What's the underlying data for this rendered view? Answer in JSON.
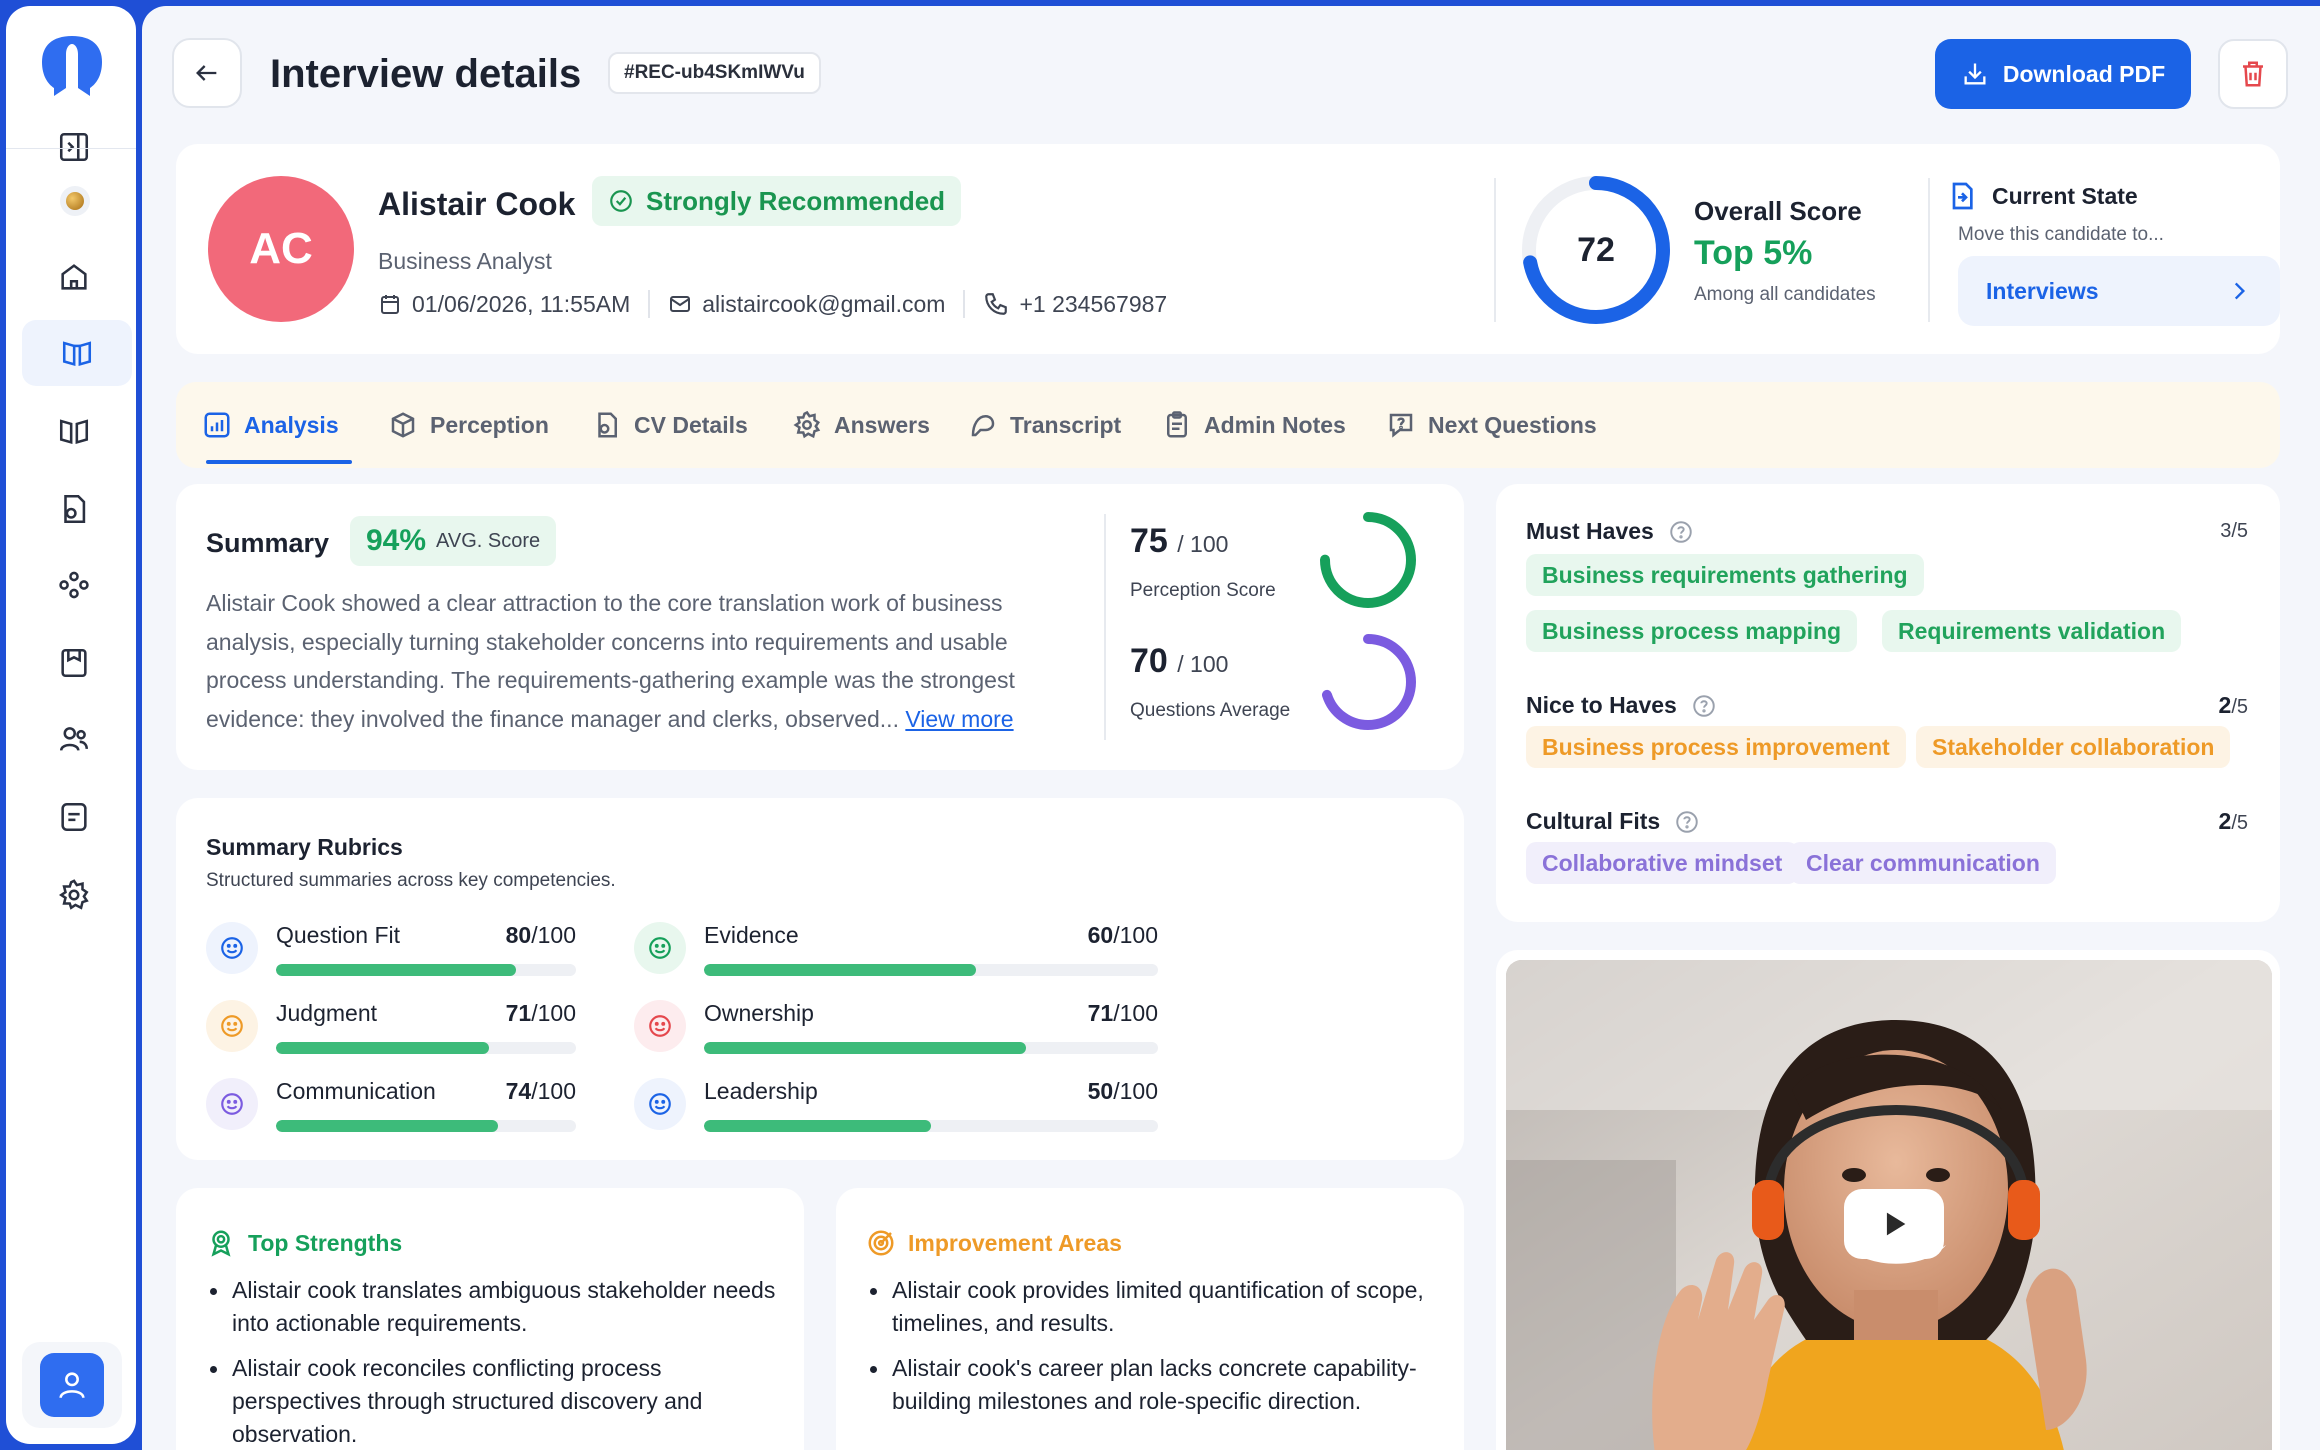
{
  "header": {
    "title": "Interview details",
    "record_id": "#REC-ub4SKmIWVu",
    "download_label": "Download PDF"
  },
  "candidate": {
    "initials": "AC",
    "name": "Alistair Cook",
    "recommendation": "Strongly Recommended",
    "role": "Business Analyst",
    "datetime": "01/06/2026, 11:55AM",
    "email": "alistaircook@gmail.com",
    "phone": "+1 234567987"
  },
  "overall": {
    "score": "72",
    "score_value": 72,
    "title": "Overall Score",
    "rank": "Top 5%",
    "rank_sub": "Among all candidates"
  },
  "current_state": {
    "title": "Current State",
    "subtitle": "Move this candidate to...",
    "stage": "Interviews"
  },
  "tabs": [
    {
      "label": "Analysis",
      "icon": "analysis-icon",
      "active": true
    },
    {
      "label": "Perception",
      "icon": "cube-icon",
      "active": false
    },
    {
      "label": "CV Details",
      "icon": "file-icon",
      "active": false
    },
    {
      "label": "Answers",
      "icon": "badge-icon",
      "active": false
    },
    {
      "label": "Transcript",
      "icon": "speech-icon",
      "active": false
    },
    {
      "label": "Admin Notes",
      "icon": "clipboard-icon",
      "active": false
    },
    {
      "label": "Next Questions",
      "icon": "question-bubble-icon",
      "active": false
    }
  ],
  "summary": {
    "title": "Summary",
    "avg_value": "94%",
    "avg_label": "AVG. Score",
    "text": "Alistair Cook showed a clear attraction to the core translation work of business analysis, especially turning stakeholder concerns into requirements and usable process understanding. The requirements-gathering example was the strongest evidence: they involved the finance manager and clerks, observed...",
    "view_more": "View more",
    "perception_score": "75",
    "perception_value": 75,
    "perception_max": "/ 100",
    "perception_label": "Perception Score",
    "questions_avg": "70",
    "questions_value": 70,
    "questions_max": "/ 100",
    "questions_label": "Questions Average"
  },
  "rubrics": {
    "title": "Summary Rubrics",
    "subtitle": "Structured summaries across key competencies.",
    "items": [
      {
        "label": "Question Fit",
        "score": "80",
        "max": "/100",
        "value": 80,
        "tone": "blue"
      },
      {
        "label": "Evidence",
        "score": "60",
        "max": "/100",
        "value": 60,
        "tone": "green"
      },
      {
        "label": "Judgment",
        "score": "71",
        "max": "/100",
        "value": 71,
        "tone": "orange"
      },
      {
        "label": "Ownership",
        "score": "71",
        "max": "/100",
        "value": 71,
        "tone": "red"
      },
      {
        "label": "Communication",
        "score": "74",
        "max": "/100",
        "value": 74,
        "tone": "purple"
      },
      {
        "label": "Leadership",
        "score": "50",
        "max": "/100",
        "value": 50,
        "tone": "blue"
      }
    ]
  },
  "strengths": {
    "title": "Top Strengths",
    "items": [
      "Alistair cook translates ambiguous stakeholder needs into actionable requirements.",
      "Alistair cook reconciles conflicting process perspectives through structured discovery and observation."
    ]
  },
  "improvements": {
    "title": "Improvement Areas",
    "items": [
      "Alistair cook provides limited quantification of scope, timelines, and results.",
      "Alistair cook's career plan lacks concrete capability-building milestones and role-specific direction."
    ]
  },
  "skills": {
    "must_haves": {
      "title": "Must Haves",
      "count": "3",
      "total": "/5",
      "chips": [
        "Business requirements gathering",
        "Business process mapping",
        "Requirements validation"
      ]
    },
    "nice_to_haves": {
      "title": "Nice to Haves",
      "count": "2",
      "total": "/5",
      "chips": [
        "Business process improvement",
        "Stakeholder collaboration"
      ]
    },
    "cultural_fits": {
      "title": "Cultural Fits",
      "count": "2",
      "total": "/5",
      "chips": [
        "Collaborative mindset",
        "Clear communication"
      ]
    }
  },
  "colors": {
    "brand": "#1b63e6",
    "success": "#16a05b",
    "danger": "#e5484d",
    "avatar": "#f2697a",
    "accent_purple": "#7b5be0",
    "accent_orange": "#ee9a27"
  }
}
